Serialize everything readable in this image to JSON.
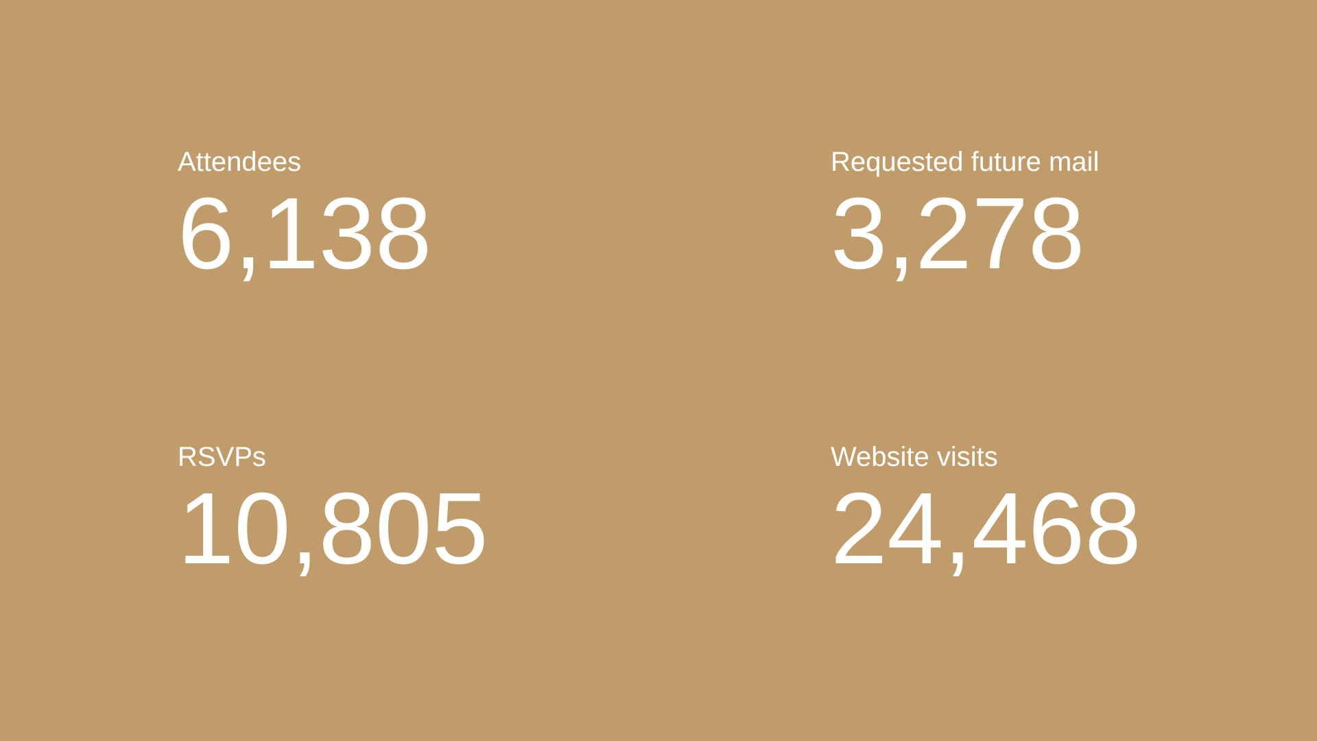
{
  "theme": {
    "background": "#c19c6b",
    "text_color": "#ffffff"
  },
  "stats": [
    {
      "label": "Attendees",
      "value": "6,138"
    },
    {
      "label": "Requested future mail",
      "value": "3,278"
    },
    {
      "label": "RSVPs",
      "value": "10,805"
    },
    {
      "label": "Website visits",
      "value": "24,468"
    }
  ]
}
